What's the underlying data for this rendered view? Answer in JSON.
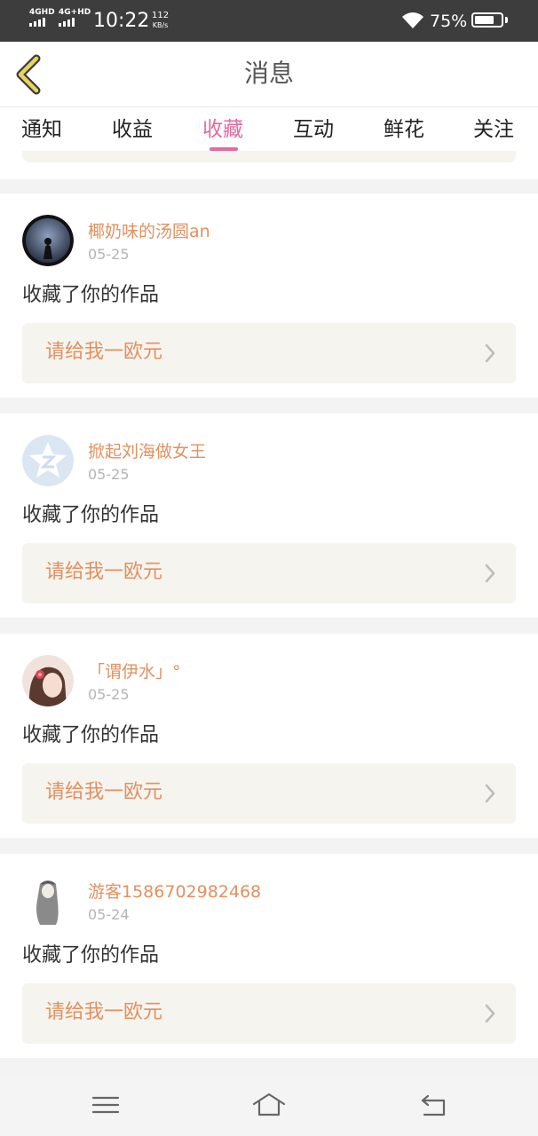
{
  "status_bar": {
    "net1": "4GHD",
    "net2": "4G+HD",
    "time": "10:22",
    "speed_value": "112",
    "speed_unit": "KB/s",
    "battery": "75%",
    "battery_level": 0.75
  },
  "header": {
    "title": "消息",
    "back_icon": "chevron-left-icon"
  },
  "tabs": [
    {
      "label": "通知",
      "active": false
    },
    {
      "label": "收益",
      "active": false
    },
    {
      "label": "收藏",
      "active": true
    },
    {
      "label": "互动",
      "active": false
    },
    {
      "label": "鲜花",
      "active": false
    },
    {
      "label": "关注",
      "active": false
    }
  ],
  "colors": {
    "accent": "#e26aa2",
    "username": "#e39060",
    "work_box_bg": "#f5f4ee"
  },
  "items": [
    {
      "user": "椰奶味的汤圆an",
      "date": "05-25",
      "action": "收藏了你的作品",
      "work": "请给我一欧元"
    },
    {
      "user": "掀起刘海做女王",
      "date": "05-25",
      "action": "收藏了你的作品",
      "work": "请给我一欧元"
    },
    {
      "user": "「谓伊水」°",
      "date": "05-25",
      "action": "收藏了你的作品",
      "work": "请给我一欧元"
    },
    {
      "user": "游客1586702982468",
      "date": "05-24",
      "action": "收藏了你的作品",
      "work": "请给我一欧元"
    }
  ],
  "navbar": {
    "menu_icon": "menu-icon",
    "home_icon": "home-icon",
    "back_icon": "back-icon"
  }
}
